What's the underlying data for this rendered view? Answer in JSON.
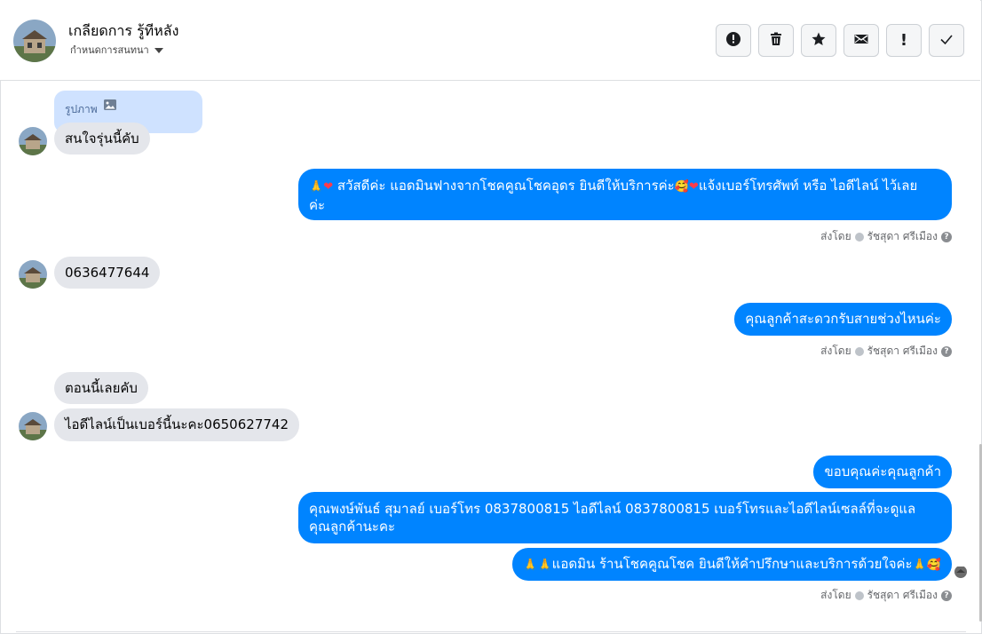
{
  "header": {
    "contact_name": "เกลียดการ รู้ทีหลัง",
    "assign_label": "กำหนดการสนทนา",
    "toolbar": [
      {
        "icon": "alert-circle-icon"
      },
      {
        "icon": "trash-icon"
      },
      {
        "icon": "star-icon"
      },
      {
        "icon": "envelope-icon"
      },
      {
        "icon": "exclamation-icon",
        "text": "!"
      },
      {
        "icon": "check-icon"
      }
    ]
  },
  "messages": {
    "attachment_label": "รูปภาพ",
    "m1": "สนใจรุ่นนี้คับ",
    "m2": "สวัสดีค่ะ แอดมินฟางจากโชคคูณโชคอุดร ยินดีให้บริการค่ะ",
    "m2_b": "แจ้งเบอร์โทรศัพท์ หรือ ไอดีไลน์  ไว้เลย",
    "m2_c": "ค่ะ",
    "m3": "0636477644",
    "m4": "คุณลูกค้าสะดวกรับสายช่วงไหนค่ะ",
    "m5": "ตอนนี้เลยคับ",
    "m6": "ไอดีไลน์เป็นเบอร์นี้นะคะ0650627742",
    "m7": "ขอบคุณค่ะคุณลูกค้า",
    "m8_a": "คุณพงษ์พันธ์ สุมาลย์      เบอร์โทร 0837800815  ไอดีไลน์ 0837800815   เบอร์โทรและไอดีไลน์เซลล์ที่จะดูแล",
    "m8_b": "คุณลูกค้านะคะ",
    "m9": "แอดมิน ร้านโชคคูณโชค ยินดีให้คำปรึกษาและบริการด้วยใจค่ะ"
  },
  "sent_meta": {
    "prefix": "ส่งโดย",
    "agent": "รัชสุดา ศรีเมือง",
    "help": "?"
  },
  "colors": {
    "outgoing": "#0084ff",
    "incoming": "#e4e6eb",
    "attachment": "#cfe2ff"
  }
}
